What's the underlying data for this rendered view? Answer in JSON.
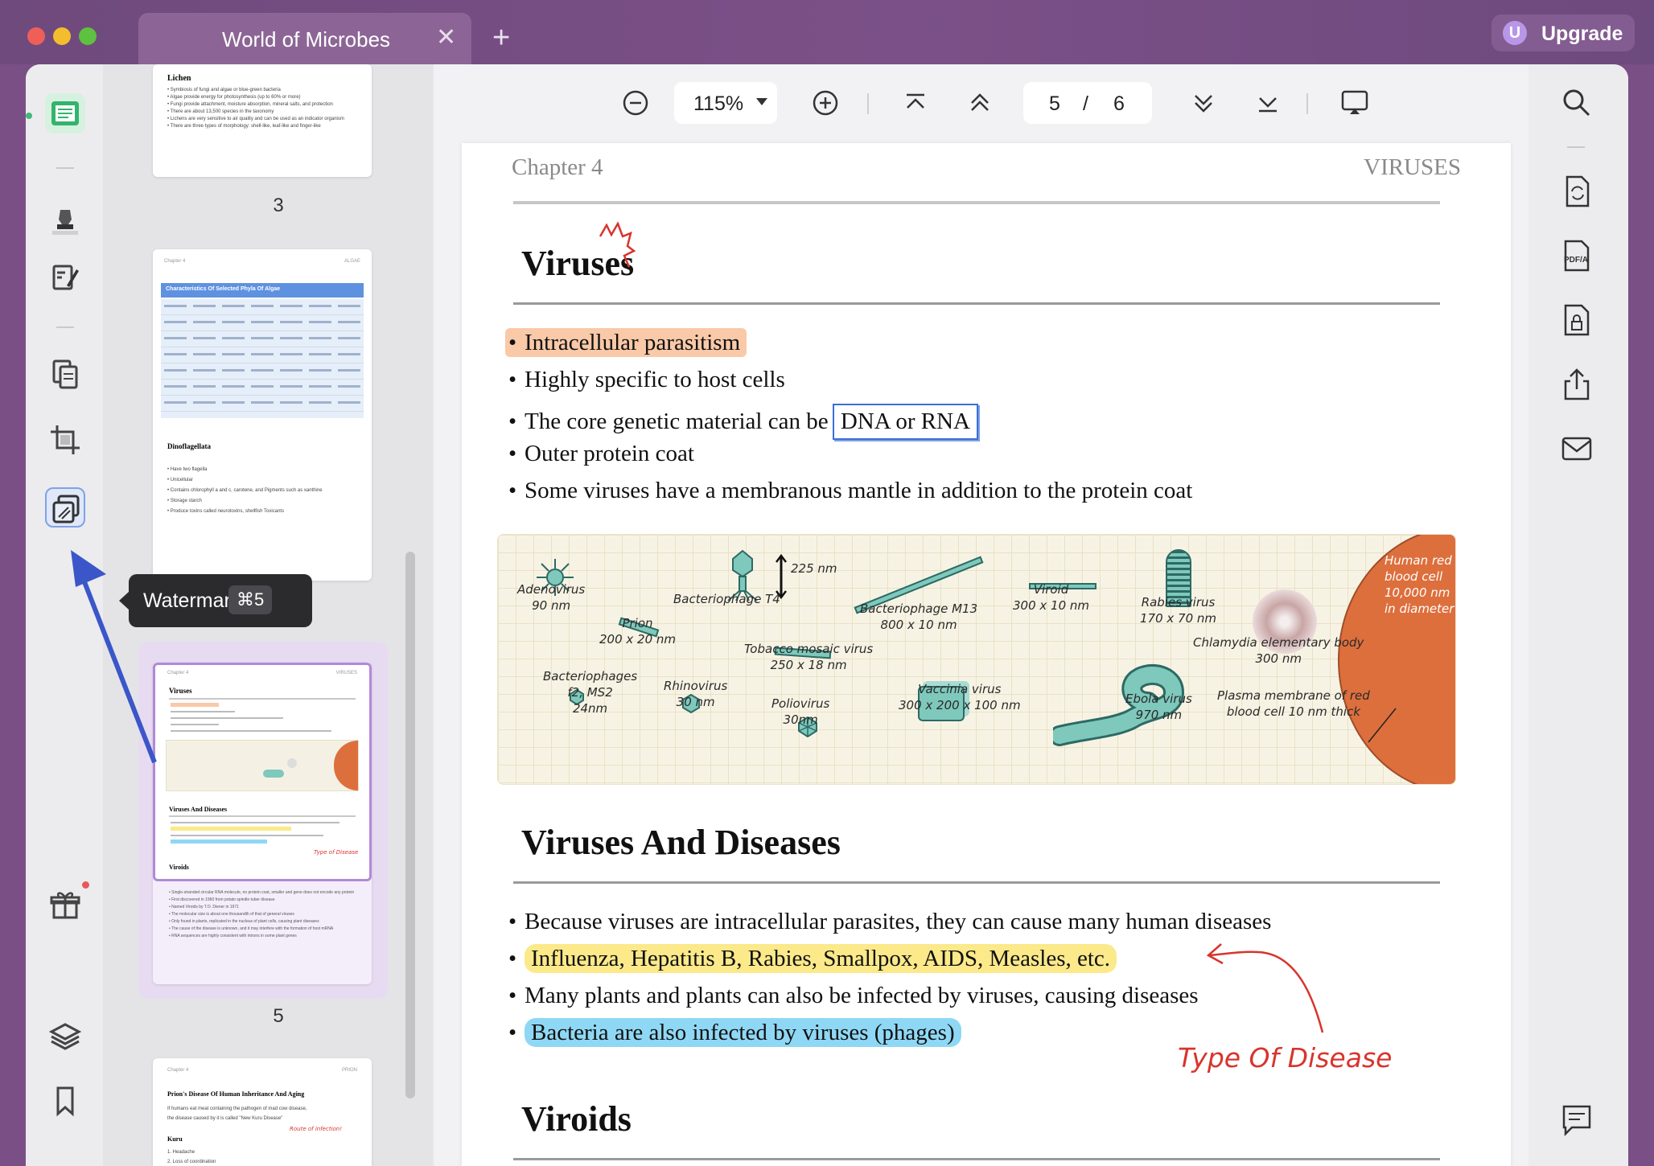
{
  "titlebar": {
    "traffic_light_colors": [
      "#ee5f57",
      "#f3bd2e",
      "#5ec13f"
    ],
    "tab_title": "World of Microbes",
    "close_icon": "close-icon",
    "add_tab_icon": "plus-icon",
    "upgrade_label": "Upgrade",
    "upgrade_badge": "U"
  },
  "toolbar": {
    "zoom": "115%",
    "current_page": "5",
    "page_separator": "/",
    "total_pages": "6"
  },
  "tooltip": {
    "label": "Watermark",
    "shortcut": "⌘5"
  },
  "thumbnails": {
    "page_numbers": [
      "3",
      "4",
      "5"
    ],
    "selected_page": "5",
    "page3": {
      "heading": "Lichen",
      "lines": [
        "Symbiosis of fungi and algae or blue-green bacteria",
        "Algae provide energy for photosynthesis (up to 60% or more)",
        "Fungi provide attachment, moisture absorption, mineral salts, and protection",
        "There are about 13,500 species in the taxonomy",
        "Lichens are very sensitive to air quality and can be used as an indicator organism",
        "There are three types of morphology: shell-like, leaf-like and finger-like"
      ]
    },
    "page4": {
      "header_left": "Chapter 4",
      "header_right": "ALGAE",
      "table_title": "Characteristics Of Selected Phyla Of Algae",
      "section": "Dinoflagellata",
      "lines": [
        "Have two flagella",
        "Unicellular",
        "Contains chlorophyll a and c, carotene, and Pigments such as xanthine",
        "Storage starch",
        "Produce toxins called neurotoxins, shellfish Toxicants"
      ]
    },
    "page5": {
      "header_left": "Chapter 4",
      "header_right": "VIRUSES",
      "title": "Viruses",
      "section2": "Viruses And Diseases",
      "section3": "Viroids",
      "note": "Type of Disease",
      "viroid_lines": [
        "Single-stranded circular RNA molecule, no protein coat, smaller and gene does not encode any protein",
        "First discovered in 1960 from potato spindle tuber disease",
        "Named Viroids by T.O. Diener in 1971",
        "The molecular size is about one thousandth of that of general viruses",
        "Only found in plants, replicated in the nucleus of plant cells, causing plant diseases",
        "The cause of the disease is unknown, and it may interfere with the formation of host mRNA",
        "RNA sequences are highly consistent with introns in some plant genes"
      ]
    },
    "page6": {
      "header_left": "Chapter 4",
      "header_right": "PRION",
      "title": "Prion's Disease Of Human Inheritance And Aging",
      "text1": "If humans eat meat containing the pathogen of mad cow disease,",
      "text2": "the disease caused by it is called \"New Kuru Disease\"",
      "note": "Route of infection!",
      "section": "Kuru",
      "items": [
        "1. Headache",
        "2. Loss of coordination"
      ]
    }
  },
  "page": {
    "header_left": "Chapter 4",
    "header_right": "VIRUSES",
    "title": "Viruses",
    "bullets": [
      "Intracellular parasitism",
      "Highly specific to host cells",
      "The core genetic material can be ",
      "Outer protein coat",
      "Some viruses have a membranous mantle in addition to the protein coat"
    ],
    "boxed_text": "DNA or RNA",
    "highlight_colors": {
      "orange": "#f9c9a8",
      "yellow": "#fbe98a",
      "blue": "#8fd8f5",
      "box": "#3b6fd8",
      "annotation": "#d8342c"
    },
    "diagram_labels": {
      "adenovirus": [
        "Adenovirus",
        "90 nm"
      ],
      "bacteriophage_t4": [
        "Bacteriophage T4"
      ],
      "t4_size": "225 nm",
      "prion": [
        "Prion",
        "200 x 20 nm"
      ],
      "m13": [
        "Bacteriophage M13",
        "800 x 10 nm"
      ],
      "viroid": [
        "Viroid",
        "300 x 10 nm"
      ],
      "rabies": [
        "Rabies virus",
        "170 x 70 nm"
      ],
      "tmv": [
        "Tobacco mosaic virus",
        "250 x 18 nm"
      ],
      "chlamydia": [
        "Chlamydia elementary body",
        "300 nm"
      ],
      "rbc": [
        "Human red",
        "blood cell",
        "10,000 nm",
        "in diameter"
      ],
      "phages_f2": [
        "Bacteriophages",
        "f2, MS2",
        "24nm"
      ],
      "rhinovirus": [
        "Rhinovirus",
        "30 nm"
      ],
      "poliovirus": [
        "Poliovirus",
        "30nm"
      ],
      "vaccinia": [
        "Vaccinia virus",
        "300 x 200 x 100 nm"
      ],
      "ebola": [
        "Ebola virus",
        "970 nm"
      ],
      "plasma": [
        "Plasma membrane of red",
        "blood cell 10 nm thick"
      ]
    },
    "section2_title": "Viruses And Diseases",
    "section2_bullets": [
      "Because viruses are intracellular parasites, they can cause many human diseases",
      "Influenza, Hepatitis B, Rabies, Smallpox, AIDS, Measles, etc.",
      "Many plants and plants can also be infected by viruses, causing diseases",
      "Bacteria are also infected by viruses (phages)"
    ],
    "annotation": "Type Of Disease",
    "section3_title": "Viroids"
  },
  "icons": {
    "left": [
      "reader-icon",
      "highlighter-icon",
      "edit-pen-icon",
      "organize-pages-icon",
      "crop-icon",
      "watermark-icon",
      "gift-icon",
      "layers-icon",
      "bookmark-icon"
    ],
    "right": [
      "search-icon",
      "convert-icon",
      "pdfa-icon",
      "protect-icon",
      "share-icon",
      "mail-icon",
      "comment-icon"
    ],
    "toolbar": [
      "zoom-out-icon",
      "zoom-in-icon",
      "first-page-icon",
      "prev-page-icon",
      "next-page-icon",
      "last-page-icon",
      "presentation-icon"
    ]
  }
}
